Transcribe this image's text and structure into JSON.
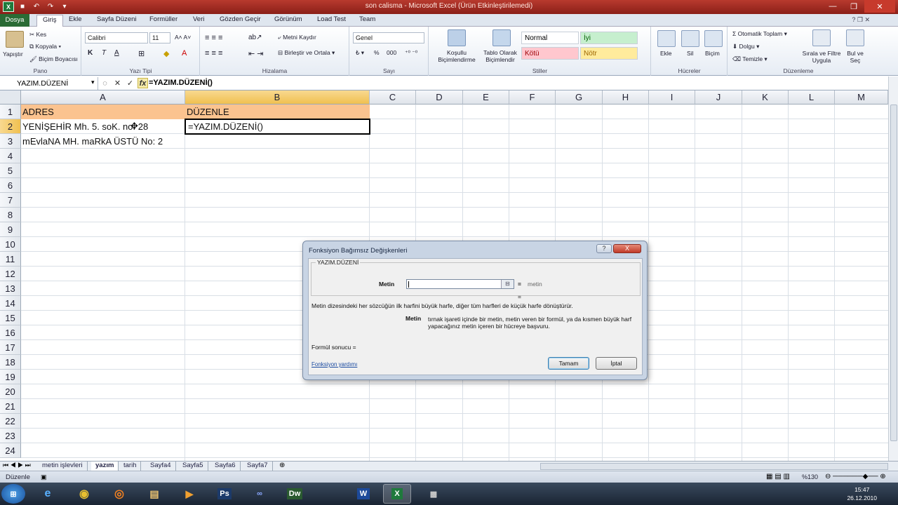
{
  "window": {
    "title": "son calisma - Microsoft Excel (Ürün Etkinleştirilemedi)"
  },
  "qat": {
    "app_icon": "X",
    "undo_icon": "undo-icon",
    "redo_icon": "redo-icon"
  },
  "tabs": [
    "Dosya",
    "Giriş",
    "Ekle",
    "Sayfa Düzeni",
    "Formüller",
    "Veri",
    "Gözden Geçir",
    "Görünüm",
    "Load Test",
    "Team"
  ],
  "ribbon": {
    "clipboard": {
      "label": "Pano",
      "paste": "Yapıştır",
      "cut": "Kes",
      "copy": "Kopyala",
      "format_painter": "Biçim Boyacısı"
    },
    "font": {
      "label": "Yazı Tipi",
      "family": "Calibri",
      "size": "11",
      "bold": "K",
      "italic": "T",
      "underline": "A"
    },
    "alignment": {
      "label": "Hizalama",
      "wrap": "Metni Kaydır",
      "merge": "Birleştir ve Ortala"
    },
    "number": {
      "label": "Sayı",
      "format": "Genel",
      "percent": "%",
      "thousands": "000"
    },
    "styles": {
      "label": "Stiller",
      "conditional": "Koşullu Biçimlendirme",
      "table": "Tablo Olarak Biçimlendir",
      "normal": "Normal",
      "good": "İyi",
      "bad": "Kötü",
      "neutral": "Nötr"
    },
    "cells": {
      "label": "Hücreler",
      "insert": "Ekle",
      "delete": "Sil",
      "format": "Biçim"
    },
    "editing": {
      "label": "Düzenleme",
      "autosum": "Otomatik Toplam",
      "fill": "Dolgu",
      "clear": "Temizle",
      "sort": "Sırala ve Filtre Uygula",
      "find": "Bul ve Seç"
    }
  },
  "formula_bar": {
    "name_box": "YAZIM.DÜZENİ",
    "formula": "=YAZIM.DÜZENİ()"
  },
  "columns": [
    "A",
    "B",
    "C",
    "D",
    "E",
    "F",
    "G",
    "H",
    "I",
    "J",
    "K",
    "L",
    "M"
  ],
  "rows": [
    "1",
    "2",
    "3",
    "4",
    "5",
    "6",
    "7",
    "8",
    "9",
    "10",
    "11",
    "12",
    "13",
    "14",
    "15",
    "16",
    "17",
    "18",
    "19",
    "20",
    "21",
    "22",
    "23",
    "24"
  ],
  "cells": {
    "A1": "ADRES",
    "B1": "DÜZENLE",
    "A2": "YENİŞEHİR Mh. 5. soK. no: 28",
    "B2": "=YAZIM.DÜZENİ()",
    "A3": "mEvlaNA MH. maRkA ÜSTÜ No: 2"
  },
  "sheets": [
    "metin işlevleri",
    "yazım",
    "tarih",
    "Sayfa4",
    "Sayfa5",
    "Sayfa6",
    "Sayfa7"
  ],
  "status": {
    "mode": "Düzenle",
    "zoom": "%130"
  },
  "taskbar": {
    "apps": [
      "start",
      "ie",
      "chrome",
      "firefox",
      "explorer",
      "media",
      "Ps",
      "link",
      "Dw",
      "W",
      "X",
      "tool"
    ],
    "time": "15:47",
    "date": "26.12.2010"
  },
  "dialog": {
    "title": "Fonksiyon Bağımsız Değişkenleri",
    "function_name": "YAZIM.DÜZENİ",
    "arg_label": "Metin",
    "arg_equals": "=",
    "arg_hint": "metin",
    "result_equals": "=",
    "description": "Metin dizesindeki her sözcüğün ilk harfini büyük harfe, diğer tüm harfleri de küçük harfe dönüştürür.",
    "arg_desc_label": "Metin",
    "arg_desc_line1": "tırnak işareti içinde bir metin, metin veren bir formül, ya da kısmen büyük harf",
    "arg_desc_line2": "yapacağınız metin içeren bir hücreye başvuru.",
    "formula_result": "Formül sonucu =",
    "help_link": "Fonksiyon yardımı",
    "ok": "Tamam",
    "cancel": "İptal",
    "help_btn": "?",
    "close_btn": "X"
  }
}
